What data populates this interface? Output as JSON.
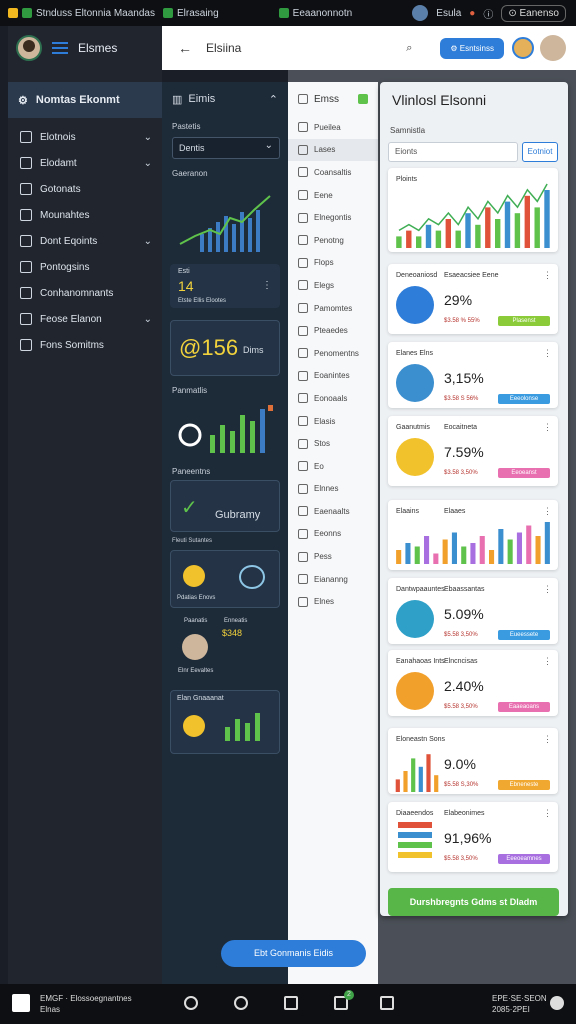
{
  "topbar": {
    "app_title": "Stnduss Eltonnia Maandas",
    "tab2": "Elrasaing",
    "tab3": "Eeaanonnotn",
    "user_label": "Esula",
    "pill_label": "Eanenso"
  },
  "sidebar": {
    "title": "Elsmes",
    "active_item": "Nomtas Ekonmt",
    "items": [
      {
        "label": "Elotnois",
        "chevron": true
      },
      {
        "label": "Elodamt",
        "chevron": true
      },
      {
        "label": "Gotonats",
        "chevron": false
      },
      {
        "label": "Mounahtes",
        "chevron": false
      },
      {
        "label": "Dont Eqoints",
        "chevron": true
      },
      {
        "label": "Pontogsins",
        "chevron": false
      },
      {
        "label": "Conhanomnants",
        "chevron": false
      },
      {
        "label": "Feose Elanon",
        "chevron": true
      },
      {
        "label": "Fons Somitms",
        "chevron": false
      }
    ]
  },
  "header": {
    "back": "←",
    "title": "Elsiina",
    "search": "⌕",
    "button": "Esntsinss"
  },
  "mid": {
    "title": "Eimis",
    "section_label": "Pastetis",
    "select_value": "Dentis",
    "chart_label": "Gaeranon",
    "stat_value": "14",
    "stat_caption": "Etste Ellis Elootes",
    "stat_label": "Esti",
    "big_number": "156",
    "big_caption": "Dims",
    "gauge_label": "Panmatlis",
    "trend_label": "Paneentns",
    "summary_label": "Gubramy",
    "summary_caption": "Fleuti Sutantes",
    "coin_caption": "Pdatias Enovs",
    "person_labels": [
      "Paanatis",
      "Enneatis"
    ],
    "person_value": "$348",
    "person_caption": "Elnr Eevaltes",
    "chart2_label": "Elan Gnaaanat"
  },
  "list": {
    "title": "Emss",
    "items": [
      "Pueilea",
      "Lases",
      "Coansaltis",
      "Eene",
      "Elnegontis",
      "Penotng",
      "Flops",
      "Elegs",
      "Pamomtes",
      "Pteaedes",
      "Penomentns",
      "Eoanintes",
      "Eonoaals",
      "Elasis",
      "Stos",
      "Eo",
      "Elnnes",
      "Eaenaalts",
      "Eeonns",
      "Pess",
      "Eiananng",
      "Elnes"
    ]
  },
  "cards": {
    "title": "Vlinlosl Elsonni",
    "search_label": "Samnistla",
    "search_value": "Eionts",
    "search_button": "Eotniot",
    "chart_label": "Ploints",
    "entries": [
      {
        "label": "Deneoaniosd",
        "label2": "Esaeacsiee Eene",
        "value": "29%",
        "caption": "$3.58 % 55%",
        "tag": "Plasenst"
      },
      {
        "label": "Elanes Elns",
        "label2": "",
        "value": "3,15%",
        "caption": "$3.58 S 56%",
        "tag": "Eeeolonse"
      },
      {
        "label": "Gaanutmis",
        "label2": "Eocaitneta",
        "value": "7.59%",
        "caption": "$3.58 3,50%",
        "tag": "Eeoeanst"
      },
      {
        "label": "Elaains",
        "label2": "Elaaes",
        "value": "",
        "caption": "",
        "tag": ""
      },
      {
        "label": "Dantwpaauntes",
        "label2": "Ebaassantas",
        "value": "5.09%",
        "caption": "$5.58 3,50%",
        "tag": "Eueessete"
      },
      {
        "label": "Eanahaoas Ints",
        "label2": "Elncncisas",
        "value": "2.40%",
        "caption": "$5.58 3,50%",
        "tag": "Eaaeaoans"
      },
      {
        "label": "Eloneastn Sons",
        "label2": "",
        "value": "9.0%",
        "caption": "$5.58 S,30%",
        "tag": "Ebneneste"
      },
      {
        "label": "Diaaeendos",
        "label2": "Elabeonimes",
        "value": "91,96%",
        "caption": "$5.58 3,50%",
        "tag": "Eeeoeamnes"
      }
    ],
    "cta": "Durshbregnts Gdms st Dladm"
  },
  "fab": "Ebt Gonmanis Eidis",
  "bottombar": {
    "left_line1": "EMGF · Elossoegnantnes",
    "left_line2": "Elnas",
    "right_line1": "EPE·SE·SEON",
    "right_line2": "2085·2PEI",
    "badge": "2"
  },
  "chart_data": [
    {
      "type": "bar",
      "title": "Ploints",
      "values": [
        2,
        3,
        2,
        4,
        3,
        5,
        3,
        6,
        4,
        7,
        5,
        8,
        6,
        9,
        7,
        10
      ],
      "ylim": [
        0,
        10
      ]
    },
    {
      "type": "bar",
      "title": "Elaains",
      "values": [
        4,
        6,
        5,
        8,
        3,
        7,
        9,
        5,
        6,
        8,
        4,
        10,
        7,
        9,
        11,
        8,
        12
      ],
      "ylim": [
        0,
        12
      ]
    },
    {
      "type": "bar",
      "title": "Eloneastn Sons",
      "values": [
        3,
        5,
        8,
        6,
        9,
        4
      ],
      "ylim": [
        0,
        10
      ]
    }
  ]
}
